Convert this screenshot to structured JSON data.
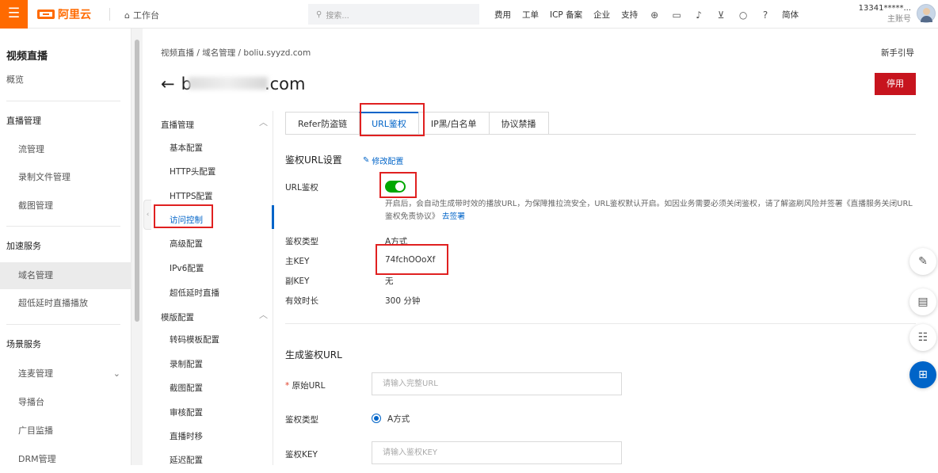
{
  "topbar": {
    "menu_icon": "menu-icon",
    "logo_text": "阿里云",
    "workbench": "工作台",
    "search_placeholder": "搜索...",
    "nav": [
      "费用",
      "工单",
      "ICP 备案",
      "企业",
      "支持"
    ],
    "language": "简体",
    "account_name": "13341*****...",
    "account_sub": "主账号"
  },
  "sidebar": {
    "title": "视频直播",
    "items": {
      "overview": "概览",
      "live_mgmt": "直播管理",
      "stream_mgmt": "流管理",
      "record_files": "录制文件管理",
      "snapshot_mgmt": "截图管理",
      "accel_service": "加速服务",
      "domain_mgmt": "域名管理",
      "ultra_low_latency": "超低延时直播播放",
      "scene_service": "场景服务",
      "mic_mgmt": "连麦管理",
      "director": "导播台",
      "ad_monitor": "广目监播",
      "drm_mgmt": "DRM管理"
    }
  },
  "breadcrumb": "视频直播  /  域名管理  /  boliu.syyzd.com",
  "guide": "新手引导",
  "page_title_prefix": "b",
  "page_title_suffix": ".com",
  "stop_button": "停用",
  "subnav": {
    "group_live": "直播管理",
    "basic_config": "基本配置",
    "http_header": "HTTP头配置",
    "https_config": "HTTPS配置",
    "access_control": "访问控制",
    "advanced_config": "高级配置",
    "ipv6_config": "IPv6配置",
    "ultra_low": "超低延时直播",
    "group_template": "模版配置",
    "transcode_tpl": "转码模板配置",
    "record_config": "录制配置",
    "snapshot_config": "截图配置",
    "review_config": "审核配置",
    "time_shift": "直播时移",
    "delay_config": "延迟配置"
  },
  "tabs": [
    "Refer防盗链",
    "URL鉴权",
    "IP黑/白名单",
    "协议禁播"
  ],
  "auth_settings": {
    "title": "鉴权URL设置",
    "edit_link": "修改配置",
    "url_auth_label": "URL鉴权",
    "description": "开启后，会自动生成带时效的播放URL，为保障推拉流安全，URL鉴权默认开启。如因业务需要必须关闭鉴权，请了解盗刷风险并签署《直播服务关闭URL鉴权免责协议》",
    "sign_link": "去签署",
    "auth_type_label": "鉴权类型",
    "auth_type_value": "A方式",
    "main_key_label": "主KEY",
    "main_key_value": "74fchOOoXf",
    "sub_key_label": "副KEY",
    "sub_key_value": "无",
    "valid_label": "有效时长",
    "valid_value": "300 分钟"
  },
  "generate": {
    "title": "生成鉴权URL",
    "origin_label": "原始URL",
    "origin_placeholder": "请输入完整URL",
    "type_label": "鉴权类型",
    "type_option": "A方式",
    "key_label": "鉴权KEY",
    "key_placeholder": "请输入鉴权KEY"
  },
  "colors": {
    "brand": "#ff6a00",
    "link": "#0064c8",
    "danger": "#c7141e",
    "switch_on": "#00a700",
    "highlight": "#e02020"
  }
}
